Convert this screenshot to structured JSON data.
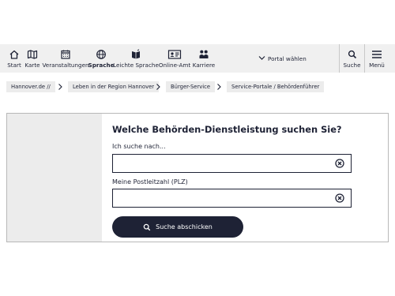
{
  "nav": {
    "items": [
      {
        "label": "Start",
        "icon": "home-icon"
      },
      {
        "label": "Karte",
        "icon": "map-icon"
      },
      {
        "label": "Veranstaltungen",
        "icon": "calendar-icon"
      },
      {
        "label": "Sprache",
        "icon": "globe-icon"
      },
      {
        "label": "Leichte Sprache",
        "icon": "easy-language-icon"
      },
      {
        "label": "Online-Amt",
        "icon": "id-card-icon"
      },
      {
        "label": "Karriere",
        "icon": "people-icon"
      }
    ],
    "portal_label": "Portal wählen",
    "search_label": "Suche",
    "menu_label": "Menü"
  },
  "breadcrumb": [
    "Hannover.de //",
    "Leben in der Region Hannover",
    "Bürger-Service",
    "Service-Portale / Behördenführer"
  ],
  "search_form": {
    "heading": "Welche Behörden-Dienstleistung suchen Sie?",
    "query_label": "Ich suche nach...",
    "query_value": "",
    "plz_label": "Meine Postleitzahl (PLZ)",
    "plz_value": "",
    "submit_label": "Suche abschicken"
  },
  "colors": {
    "primary": "#1e2235",
    "nav_background": "#f0f0f0",
    "panel_side": "#ececec"
  }
}
